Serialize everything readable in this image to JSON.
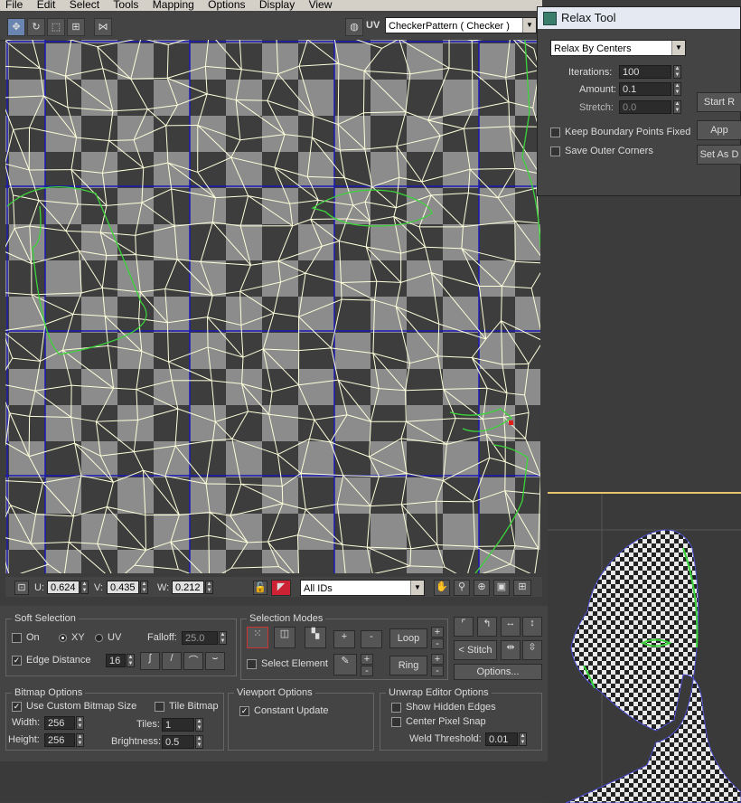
{
  "menu": [
    "File",
    "Edit",
    "Select",
    "Tools",
    "Mapping",
    "Options",
    "Display",
    "View"
  ],
  "toolbar": {
    "uv_label": "UV",
    "texture_combo": "CheckerPattern  ( Checker )"
  },
  "status": {
    "u_label": "U:",
    "u_value": "0.624",
    "v_label": "V:",
    "v_value": "0.435",
    "w_label": "W:",
    "w_value": "0.212",
    "ids_combo": "All IDs"
  },
  "soft_selection": {
    "title": "Soft Selection",
    "on_label": "On",
    "xy_label": "XY",
    "uv_label": "UV",
    "falloff_label": "Falloff:",
    "falloff_value": "25.0",
    "edge_distance_label": "Edge Distance",
    "edge_distance_value": "16"
  },
  "selection_modes": {
    "title": "Selection Modes",
    "plus": "+",
    "minus": "-",
    "loop_label": "Loop",
    "ring_label": "Ring",
    "select_element_label": "Select Element"
  },
  "stitch": {
    "stitch_label": "< Stitch >",
    "options_label": "Options..."
  },
  "bitmap_options": {
    "title": "Bitmap Options",
    "custom_size_label": "Use Custom Bitmap Size",
    "tile_label": "Tile Bitmap",
    "width_label": "Width:",
    "width_value": "256",
    "height_label": "Height:",
    "height_value": "256",
    "tiles_label": "Tiles:",
    "tiles_value": "1",
    "brightness_label": "Brightness:",
    "brightness_value": "0.5"
  },
  "viewport_options": {
    "title": "Viewport Options",
    "constant_update_label": "Constant Update"
  },
  "unwrap_editor_options": {
    "title": "Unwrap Editor Options",
    "show_hidden_label": "Show Hidden Edges",
    "center_pixel_label": "Center Pixel Snap",
    "weld_label": "Weld Threshold:",
    "weld_value": "0.01"
  },
  "relax_tool": {
    "title": "Relax Tool",
    "method": "Relax By Centers",
    "iterations_label": "Iterations:",
    "iterations_value": "100",
    "amount_label": "Amount:",
    "amount_value": "0.1",
    "stretch_label": "Stretch:",
    "stretch_value": "0.0",
    "keep_boundary_label": "Keep Boundary Points Fixed",
    "save_corners_label": "Save Outer Corners",
    "start_label": "Start R",
    "apply_label": "App",
    "set_default_label": "Set As D"
  },
  "colors": {
    "grid_line": "#1a1ab4",
    "mesh_edge": "#ffffdc",
    "selected_edge": "#3ad43a",
    "checker_dark": "#3d3d3d",
    "checker_light": "#8c8c8c"
  }
}
